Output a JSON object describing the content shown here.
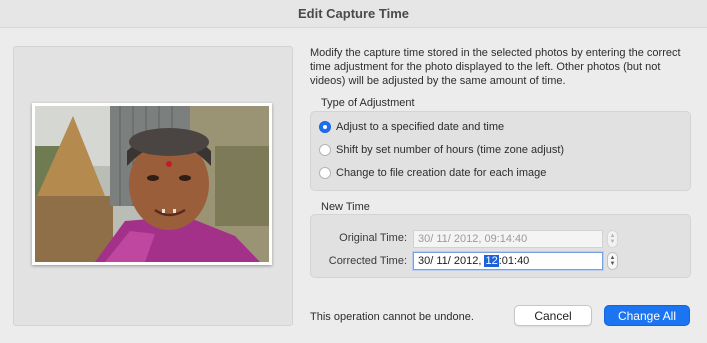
{
  "window": {
    "title": "Edit Capture Time"
  },
  "description": "Modify the capture time stored in the selected photos by entering the correct time adjustment for the photo displayed to the left. Other photos (but not videos) will be adjusted by the same amount of time.",
  "adjustment": {
    "label": "Type of Adjustment",
    "options": [
      {
        "label": "Adjust to a specified date and time",
        "checked": true
      },
      {
        "label": "Shift by set number of hours (time zone adjust)",
        "checked": false
      },
      {
        "label": "Change to file creation date for each image",
        "checked": false
      }
    ]
  },
  "new_time": {
    "label": "New Time",
    "original_label": "Original Time:",
    "original_value": "30/ 11/ 2012, 09:14:40",
    "corrected_label": "Corrected Time:",
    "corrected_date": "30/ 11/ 2012,",
    "corrected_hour": "12",
    "corrected_rest": ":01:40"
  },
  "footer": {
    "warning": "This operation cannot be undone.",
    "cancel_label": "Cancel",
    "primary_label": "Change All"
  },
  "colors": {
    "accent": "#1b74f2",
    "selection": "#1c63d8"
  },
  "icons": {
    "stepper": "up-down-stepper-icon",
    "radio": "radio-button"
  }
}
